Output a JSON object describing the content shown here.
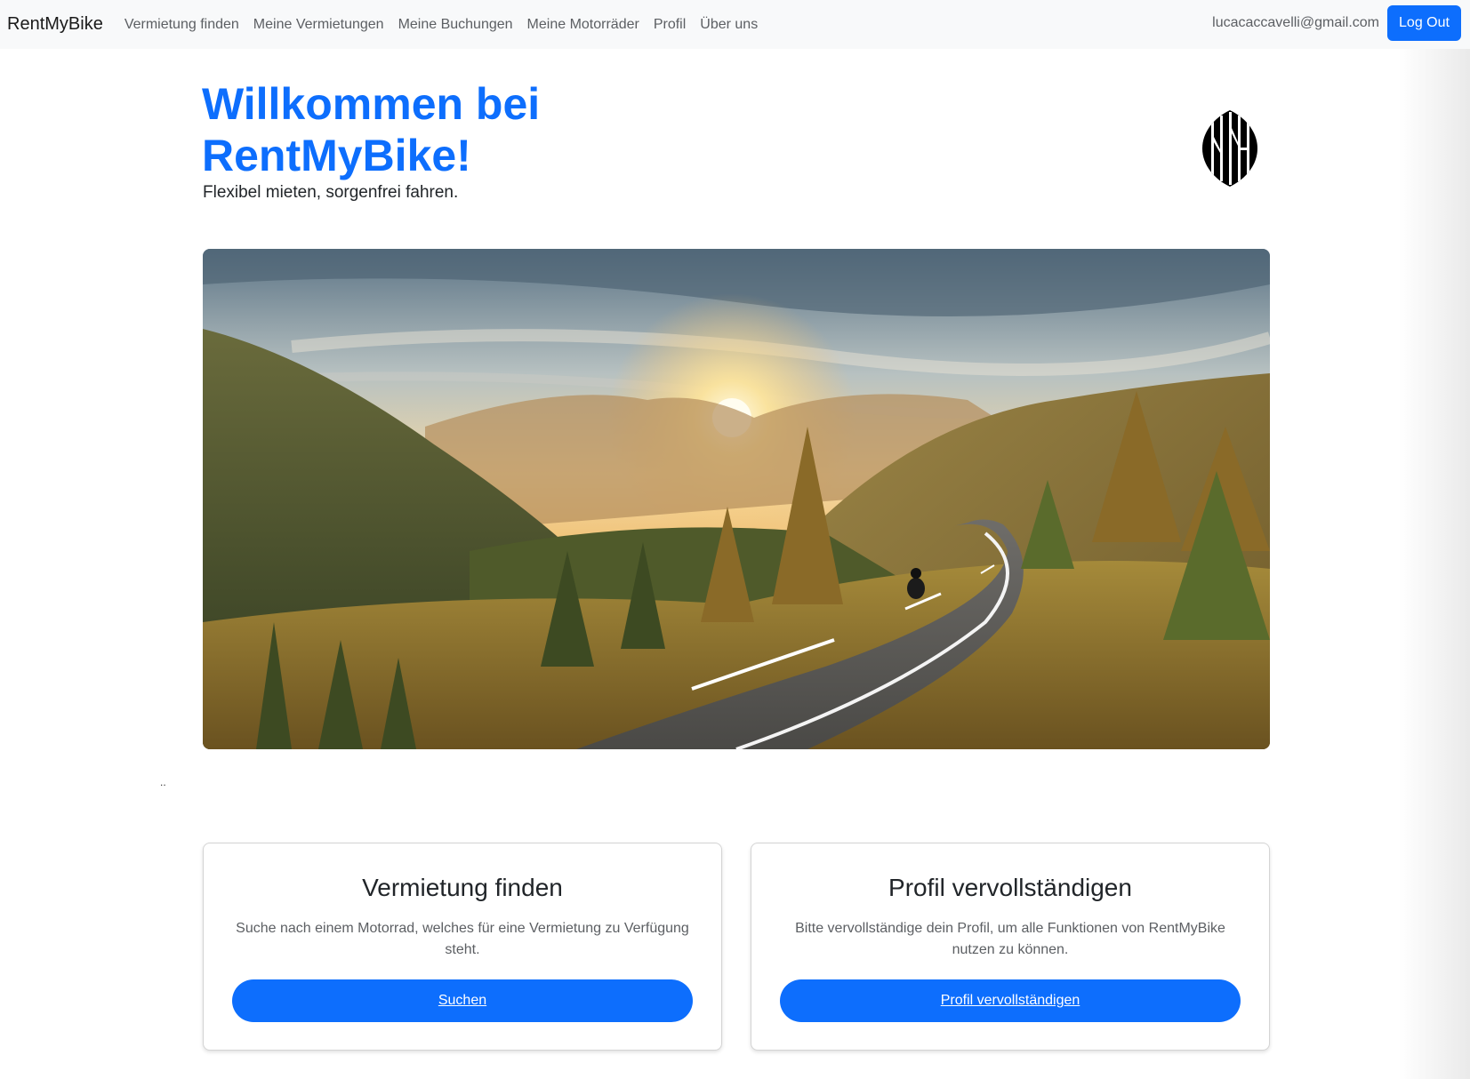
{
  "navbar": {
    "brand": "RentMyBike",
    "links": [
      {
        "label": "Vermietung finden"
      },
      {
        "label": "Meine Vermietungen"
      },
      {
        "label": "Meine Buchungen"
      },
      {
        "label": "Meine Motorräder"
      },
      {
        "label": "Profil"
      },
      {
        "label": "Über uns"
      }
    ],
    "user_email": "lucacaccavelli@gmail.com",
    "logout_label": "Log Out"
  },
  "hero": {
    "title": "Willkommen bei RentMyBike!",
    "subtitle": "Flexibel mieten, sorgenfrei fahren.",
    "logo_text": "RMB"
  },
  "banner": {
    "icon": "landscape-motorcycle-image"
  },
  "misc": {
    "dots": ".."
  },
  "cards": [
    {
      "title": "Vermietung finden",
      "text": "Suche nach einem Motorrad, welches für eine Vermietung zu Verfügung steht.",
      "button_label": "Suchen"
    },
    {
      "title": "Profil vervollständigen",
      "text": "Bitte vervollständige dein Profil, um alle Funktionen von RentMyBike nutzen zu können.",
      "button_label": "Profil vervollständigen"
    }
  ],
  "colors": {
    "primary": "#0d6efd",
    "navbar_bg": "#f8f9fa"
  }
}
